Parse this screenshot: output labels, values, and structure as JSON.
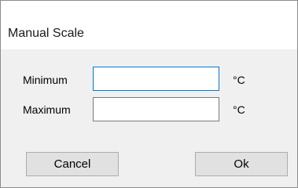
{
  "window": {
    "title": "Manual Scale"
  },
  "form": {
    "minimum": {
      "label": "Minimum",
      "value": "",
      "unit": "°C"
    },
    "maximum": {
      "label": "Maximum",
      "value": "",
      "unit": "°C"
    }
  },
  "buttons": {
    "cancel_label": "Cancel",
    "ok_label": "Ok"
  },
  "colors": {
    "focus_border": "#0078d7",
    "dialog_background": "#f0f0f0",
    "title_background": "#ffffff"
  }
}
